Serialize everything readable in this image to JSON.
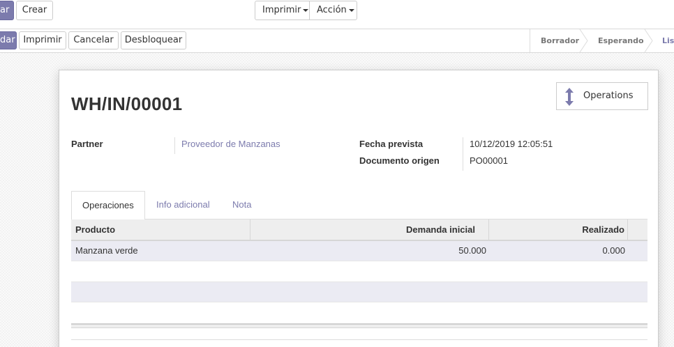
{
  "toolbar": {
    "edit_label_partial": "ar",
    "create_label": "Crear",
    "print_label": "Imprimir",
    "action_label": "Acción"
  },
  "statusbar": {
    "validate_label_partial": "dar",
    "print_label": "Imprimir",
    "cancel_label": "Cancelar",
    "unlock_label": "Desbloquear",
    "stages": [
      "Borrador",
      "Esperando",
      "Lis"
    ]
  },
  "record": {
    "title": "WH/IN/00001",
    "smart_button_label": "Operations",
    "partner_label": "Partner",
    "partner_value": "Proveedor de Manzanas",
    "scheduled_label": "Fecha prevista",
    "scheduled_value": "10/12/2019 12:05:51",
    "origin_label": "Documento origen",
    "origin_value": "PO00001"
  },
  "tabs": [
    "Operaciones",
    "Info adicional",
    "Nota"
  ],
  "table": {
    "headers": [
      "Producto",
      "Demanda inicial",
      "Realizado"
    ],
    "rows": [
      {
        "product": "Manzana verde",
        "demand": "50.000",
        "done": "0.000"
      }
    ]
  },
  "colors": {
    "accent": "#7c7bad"
  }
}
